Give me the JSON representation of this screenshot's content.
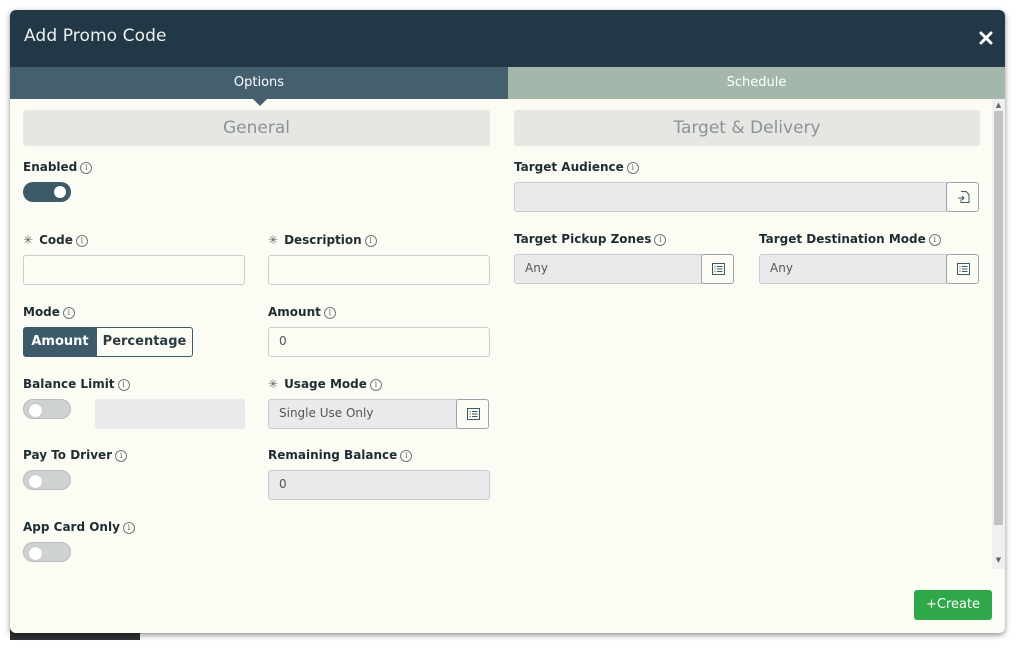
{
  "dialog": {
    "title": "Add Promo Code"
  },
  "tabs": {
    "options": "Options",
    "schedule": "Schedule"
  },
  "general": {
    "header": "General",
    "enabled": {
      "label": "Enabled",
      "value": true
    },
    "code": {
      "label": "Code",
      "value": ""
    },
    "description": {
      "label": "Description",
      "value": ""
    },
    "mode": {
      "label": "Mode",
      "options": [
        "Amount",
        "Percentage"
      ],
      "selected": "Amount"
    },
    "amount": {
      "label": "Amount",
      "value": "0"
    },
    "balance_limit": {
      "label": "Balance Limit",
      "value": false
    },
    "usage_mode": {
      "label": "Usage Mode",
      "value": "Single Use Only"
    },
    "pay_to_driver": {
      "label": "Pay To Driver",
      "value": false
    },
    "remaining_balance": {
      "label": "Remaining Balance",
      "value": "0"
    },
    "app_card_only": {
      "label": "App Card Only",
      "value": false
    }
  },
  "target": {
    "header": "Target & Delivery",
    "audience": {
      "label": "Target Audience",
      "value": ""
    },
    "pickup_zones": {
      "label": "Target Pickup Zones",
      "value": "Any"
    },
    "destination_mode": {
      "label": "Target Destination Mode",
      "value": "Any"
    }
  },
  "footer": {
    "create_label": "Create"
  },
  "colors": {
    "titlebar": "#223846",
    "tab_active": "#44606e",
    "tab_inactive": "#a3b7aa",
    "accent": "#3d5a68",
    "create": "#2ea848"
  },
  "icons": {
    "close": "close-icon",
    "list": "list-icon",
    "import": "import-icon",
    "info": "info-icon",
    "plus": "plus-icon"
  }
}
